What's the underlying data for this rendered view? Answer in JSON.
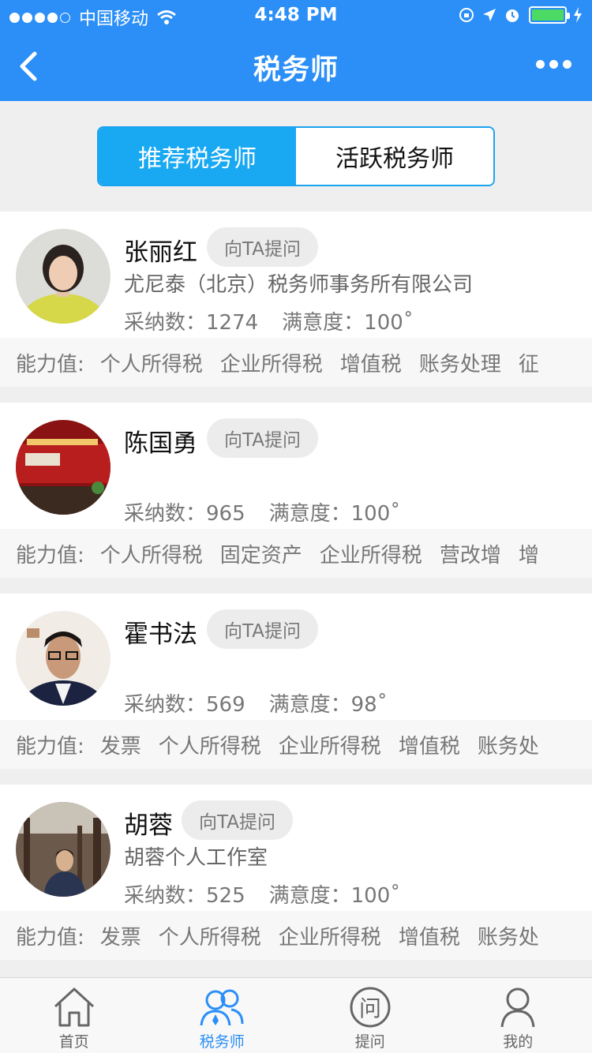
{
  "status_bar": {
    "carrier": "中国移动",
    "time": "4:48 PM"
  },
  "nav": {
    "title": "税务师"
  },
  "segment": {
    "tabs": [
      "推荐税务师",
      "活跃税务师"
    ],
    "active_index": 0
  },
  "ask_label": "向TA提问",
  "skills_label": "能力值:",
  "advisors": [
    {
      "name": "张丽红",
      "company": "尤尼泰（北京）税务师事务所有限公司",
      "adopted": "采纳数：1274",
      "satisfaction": "满意度：100˚",
      "skills": [
        "个人所得税",
        "企业所得税",
        "增值税",
        "账务处理",
        "征"
      ]
    },
    {
      "name": "陈国勇",
      "company": "",
      "adopted": "采纳数：965",
      "satisfaction": "满意度：100˚",
      "skills": [
        "个人所得税",
        "固定资产",
        "企业所得税",
        "营改增",
        "增"
      ]
    },
    {
      "name": "霍书法",
      "company": "",
      "adopted": "采纳数：569",
      "satisfaction": "满意度：98˚",
      "skills": [
        "发票",
        "个人所得税",
        "企业所得税",
        "增值税",
        "账务处"
      ]
    },
    {
      "name": "胡蓉",
      "company": "胡蓉个人工作室",
      "adopted": "采纳数：525",
      "satisfaction": "满意度：100˚",
      "skills": [
        "发票",
        "个人所得税",
        "企业所得税",
        "增值税",
        "账务处"
      ]
    }
  ],
  "tabbar": {
    "items": [
      {
        "label": "首页",
        "icon": "home-icon"
      },
      {
        "label": "税务师",
        "icon": "people-icon"
      },
      {
        "label": "提问",
        "icon": "ask-icon"
      },
      {
        "label": "我的",
        "icon": "profile-icon"
      }
    ],
    "active_index": 1
  },
  "colors": {
    "primary": "#2b8ff7",
    "segment_active": "#19a8f2",
    "battery": "#4cd964"
  }
}
